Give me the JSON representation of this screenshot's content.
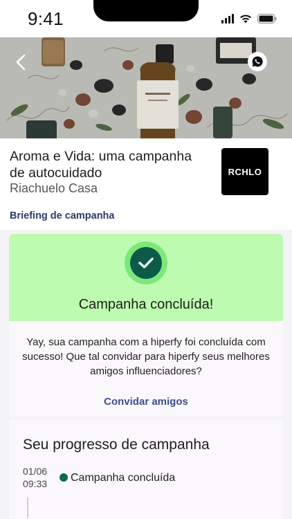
{
  "status_bar": {
    "time": "9:41"
  },
  "hero": {
    "icons": [
      "back-icon",
      "whatsapp-icon"
    ]
  },
  "campaign": {
    "title": "Aroma e Vida: uma campanha de autocuidado",
    "brand": "Riachuelo Casa",
    "brand_logo_text": "RCHLO",
    "briefing_label": "Briefing de campanha"
  },
  "status_card": {
    "title": "Campanha concluída!",
    "message": "Yay, sua campanha com a hiperfy foi concluída com sucesso! Que tal convidar para hiperfy seus melhores amigos influenciadores?",
    "invite_label": "Convidar amigos",
    "colors": {
      "background": "#bdfbb0",
      "check": "#0c5a48"
    }
  },
  "progress": {
    "title": "Seu progresso de campanha",
    "events": [
      {
        "date": "01/06",
        "time": "09:33",
        "label": "Campanha concluída"
      }
    ]
  }
}
